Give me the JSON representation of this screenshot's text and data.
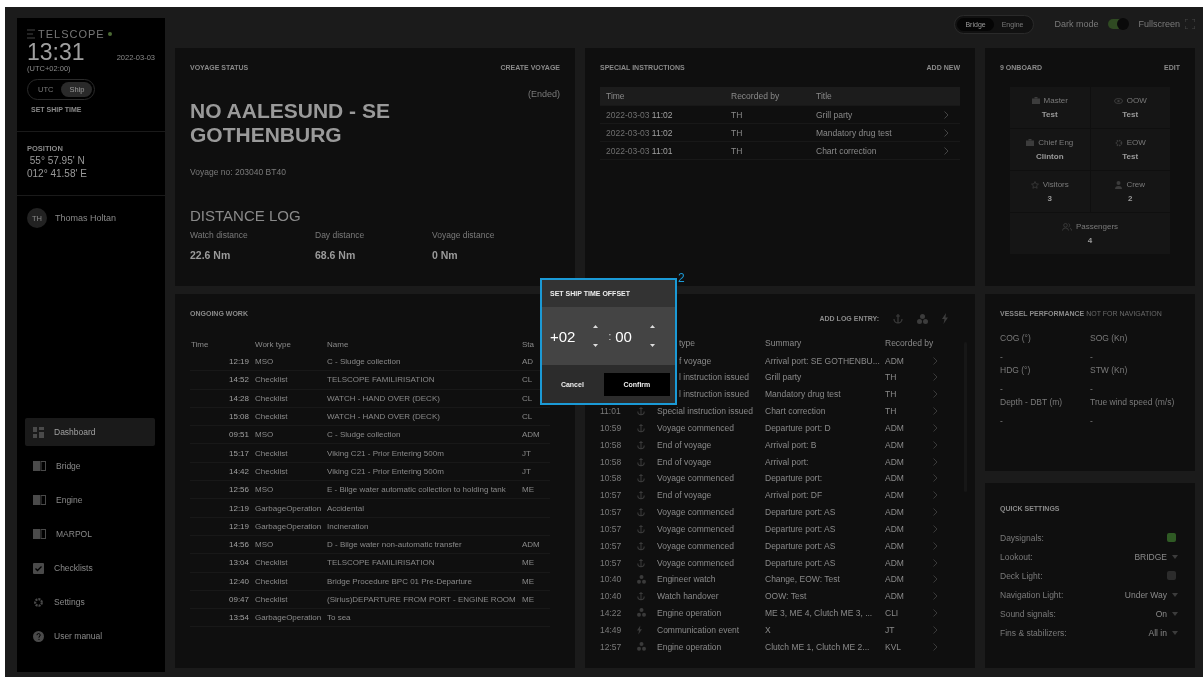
{
  "sidebar": {
    "logo": "TELSCOPE",
    "clock": {
      "time": "13:31",
      "date": "2022-03-03",
      "offset": "(UTC+02:00)"
    },
    "time_modes": [
      {
        "label": "UTC",
        "selected": false
      },
      {
        "label": "Ship",
        "selected": true
      }
    ],
    "set_ship_time": "SET SHIP TIME",
    "position": {
      "label": "POSITION",
      "lat": "55° 57.95' N",
      "lon": "012° 41.58' E"
    },
    "user": {
      "initials": "TH",
      "name": "Thomas Holtan"
    },
    "nav": [
      {
        "label": "Dashboard",
        "selected": true
      },
      {
        "label": "Bridge",
        "selected": false
      },
      {
        "label": "Engine",
        "selected": false
      },
      {
        "label": "MARPOL",
        "selected": false
      },
      {
        "label": "Checklists",
        "selected": false
      },
      {
        "label": "Settings",
        "selected": false
      },
      {
        "label": "User manual",
        "selected": false
      }
    ]
  },
  "topbar": {
    "views": [
      {
        "label": "Bridge",
        "selected": true
      },
      {
        "label": "Engine",
        "selected": false
      }
    ],
    "dark_mode": {
      "label": "Dark mode",
      "on": true
    },
    "fullscreen": "Fullscreen"
  },
  "voyage_status": {
    "title": "VOYAGE STATUS",
    "action": "CREATE VOYAGE",
    "state": "(Ended)",
    "route": "NO AALESUND - SE GOTHENBURG",
    "voyage_no": "Voyage no: 203040 BT40",
    "distance_log": {
      "title": "DISTANCE LOG",
      "items": [
        {
          "label": "Watch distance",
          "value": "22.6 Nm"
        },
        {
          "label": "Day distance",
          "value": "68.6 Nm"
        },
        {
          "label": "Voyage distance",
          "value": "0 Nm"
        }
      ]
    }
  },
  "special_instructions": {
    "title": "SPECIAL INSTRUCTIONS",
    "action": "ADD NEW",
    "columns": [
      "Time",
      "Recorded by",
      "Title"
    ],
    "rows": [
      {
        "date": "2022-03-03",
        "time": "11:02",
        "recorded_by": "TH",
        "title": "Grill party"
      },
      {
        "date": "2022-03-03",
        "time": "11:02",
        "recorded_by": "TH",
        "title": "Mandatory drug test"
      },
      {
        "date": "2022-03-03",
        "time": "11:01",
        "recorded_by": "TH",
        "title": "Chart correction"
      }
    ]
  },
  "onboard": {
    "title": "9 ONBOARD",
    "action": "EDIT",
    "roles": [
      {
        "label": "Master",
        "value": "Test"
      },
      {
        "label": "OOW",
        "value": "Test"
      },
      {
        "label": "Chief Eng",
        "value": "Clinton"
      },
      {
        "label": "EOW",
        "value": "Test"
      },
      {
        "label": "Visitors",
        "value": "3"
      },
      {
        "label": "Crew",
        "value": "2"
      },
      {
        "label": "Passengers",
        "value": "4"
      }
    ]
  },
  "ongoing_work": {
    "title": "ONGOING WORK",
    "columns": [
      "Time",
      "Work type",
      "Name",
      "Sta"
    ],
    "rows": [
      {
        "time": "12:19",
        "type": "MSO",
        "name": "C - Sludge collection",
        "status": "AD"
      },
      {
        "time": "14:52",
        "type": "Checklist",
        "name": "TELSCOPE FAMILIRISATION",
        "status": "CL"
      },
      {
        "time": "14:28",
        "type": "Checklist",
        "name": "WATCH - HAND OVER (DECK)",
        "status": "CL"
      },
      {
        "time": "15:08",
        "type": "Checklist",
        "name": "WATCH - HAND OVER (DECK)",
        "status": "CL"
      },
      {
        "time": "09:51",
        "type": "MSO",
        "name": "C - Sludge collection",
        "status": "ADM"
      },
      {
        "time": "15:17",
        "type": "Checklist",
        "name": "Viking C21 - Prior Entering 500m",
        "status": "JT"
      },
      {
        "time": "14:42",
        "type": "Checklist",
        "name": "Viking C21 - Prior Entering 500m",
        "status": "JT"
      },
      {
        "time": "12:56",
        "type": "MSO",
        "name": "E - Bilge water automatic collection to holding tank",
        "status": "ME"
      },
      {
        "time": "12:19",
        "type": "GarbageOperation",
        "name": "Accidental"
      },
      {
        "time": "12:19",
        "type": "GarbageOperation",
        "name": "Incineration"
      },
      {
        "time": "14:56",
        "type": "MSO",
        "name": "D - Bilge water non-automatic transfer",
        "status": "ADM"
      },
      {
        "time": "13:04",
        "type": "Checklist",
        "name": "TELSCOPE FAMILIRISATION",
        "status": "ME"
      },
      {
        "time": "12:40",
        "type": "Checklist",
        "name": "Bridge Procedure BPC 01 Pre-Departure",
        "status": "ME"
      },
      {
        "time": "09:47",
        "type": "Checklist",
        "name": "(Sirius)DEPARTURE FROM PORT - ENGINE ROOM",
        "status": "ME"
      },
      {
        "time": "13:54",
        "type": "GarbageOperation",
        "name": "To sea"
      }
    ]
  },
  "log": {
    "action": "ADD LOG ENTRY:",
    "columns": [
      "type",
      "Summary",
      "Recorded by"
    ],
    "rows": [
      {
        "type": "f voyage",
        "summary": "Arrival port: SE GOTHENBU...",
        "recorded_by": "ADM"
      },
      {
        "type": "l instruction issued",
        "summary": "Grill party",
        "recorded_by": "TH"
      },
      {
        "type": "l instruction issued",
        "summary": "Mandatory drug test",
        "recorded_by": "TH"
      },
      {
        "time": "11:01",
        "kind": "nautical",
        "type": "Special instruction issued",
        "summary": "Chart correction",
        "recorded_by": "TH"
      },
      {
        "time": "10:59",
        "kind": "nautical",
        "type": "Voyage commenced",
        "summary": "Departure port: D",
        "recorded_by": "ADM"
      },
      {
        "time": "10:58",
        "kind": "nautical",
        "type": "End of voyage",
        "summary": "Arrival port: B",
        "recorded_by": "ADM"
      },
      {
        "time": "10:58",
        "kind": "nautical",
        "type": "End of voyage",
        "summary": "Arrival port:",
        "recorded_by": "ADM"
      },
      {
        "time": "10:58",
        "kind": "nautical",
        "type": "Voyage commenced",
        "summary": "Departure port:",
        "recorded_by": "ADM"
      },
      {
        "time": "10:57",
        "kind": "nautical",
        "type": "End of voyage",
        "summary": "Arrival port: DF",
        "recorded_by": "ADM"
      },
      {
        "time": "10:57",
        "kind": "nautical",
        "type": "Voyage commenced",
        "summary": "Departure port: AS",
        "recorded_by": "ADM"
      },
      {
        "time": "10:57",
        "kind": "nautical",
        "type": "Voyage commenced",
        "summary": "Departure port: AS",
        "recorded_by": "ADM"
      },
      {
        "time": "10:57",
        "kind": "nautical",
        "type": "Voyage commenced",
        "summary": "Departure port: AS",
        "recorded_by": "ADM"
      },
      {
        "time": "10:57",
        "kind": "nautical",
        "type": "Voyage commenced",
        "summary": "Departure port: AS",
        "recorded_by": "ADM"
      },
      {
        "time": "10:40",
        "kind": "engine",
        "type": "Engineer watch",
        "summary": "Change, EOW: Test",
        "recorded_by": "ADM"
      },
      {
        "time": "10:40",
        "kind": "nautical",
        "type": "Watch handover",
        "summary": "OOW: Test",
        "recorded_by": "ADM"
      },
      {
        "time": "14:22",
        "kind": "engine",
        "type": "Engine operation",
        "summary": "ME 3, ME 4, Clutch ME 3, ...",
        "recorded_by": "CLI"
      },
      {
        "time": "14:49",
        "kind": "communication",
        "type": "Communication event",
        "summary": "X",
        "recorded_by": "JT"
      },
      {
        "time": "12:57",
        "kind": "engine",
        "type": "Engine operation",
        "summary": "Clutch ME 1, Clutch ME 2...",
        "recorded_by": "KVL"
      }
    ]
  },
  "vessel_performance": {
    "title": "VESSEL PERFORMANCE",
    "note": "NOT FOR NAVIGATION",
    "metrics": [
      {
        "label": "COG (°)",
        "value": "-"
      },
      {
        "label": "SOG (Kn)",
        "value": "-"
      },
      {
        "label": "HDG (°)",
        "value": "-"
      },
      {
        "label": "STW (Kn)",
        "value": "-"
      },
      {
        "label": "Depth - DBT (m)",
        "value": "-"
      },
      {
        "label": "True wind speed (m/s)",
        "value": "-"
      }
    ]
  },
  "quick_settings": {
    "title": "QUICK SETTINGS",
    "items": [
      {
        "kind": "toggle",
        "label": "Daysignals:",
        "on": true
      },
      {
        "kind": "select",
        "label": "Lookout:",
        "value": "BRIDGE"
      },
      {
        "kind": "toggle",
        "label": "Deck Light:",
        "on": false
      },
      {
        "kind": "select",
        "label": "Navigation Light:",
        "value": "Under Way"
      },
      {
        "kind": "select",
        "label": "Sound signals:",
        "value": "On"
      },
      {
        "kind": "select",
        "label": "Fins & stabilizers:",
        "value": "All in"
      }
    ]
  },
  "dialog": {
    "title": "SET SHIP TIME OFFSET",
    "hours": "+02",
    "separator": ":",
    "minutes": "00",
    "buttons": [
      {
        "label": "Cancel",
        "kind": "text"
      },
      {
        "label": "Confirm",
        "kind": "primary"
      }
    ],
    "marker": "2"
  }
}
